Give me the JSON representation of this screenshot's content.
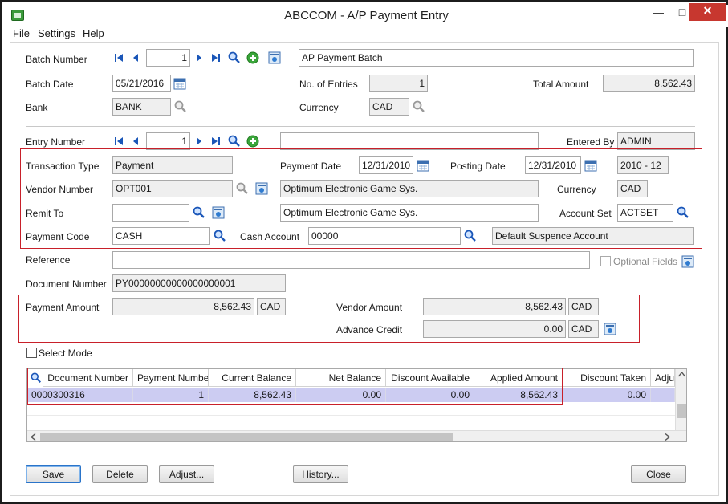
{
  "window": {
    "title": "ABCCOM - A/P Payment Entry",
    "min": "—",
    "max": "□",
    "close": "✕"
  },
  "menu": [
    "File",
    "Settings",
    "Help"
  ],
  "batch": {
    "number_label": "Batch Number",
    "number": "1",
    "description": "AP Payment Batch",
    "date_label": "Batch Date",
    "date": "05/21/2016",
    "entries_label": "No. of Entries",
    "entries": "1",
    "total_label": "Total Amount",
    "total": "8,562.43",
    "bank_label": "Bank",
    "bank": "BANK",
    "currency_label": "Currency",
    "currency": "CAD"
  },
  "entry": {
    "number_label": "Entry Number",
    "number": "1",
    "description": "",
    "entered_by_label": "Entered By",
    "entered_by": "ADMIN",
    "trans_type_label": "Transaction Type",
    "trans_type": "Payment",
    "payment_date_label": "Payment Date",
    "payment_date": "12/31/2010",
    "posting_date_label": "Posting Date",
    "posting_date": "12/31/2010",
    "period": "2010 - 12",
    "vendor_label": "Vendor Number",
    "vendor": "OPT001",
    "vendor_name": "Optimum Electronic Game Sys.",
    "vendor_currency_label": "Currency",
    "vendor_currency": "CAD",
    "remit_label": "Remit To",
    "remit": "",
    "remit_name": "Optimum Electronic Game Sys.",
    "account_set_label": "Account Set",
    "account_set": "ACTSET",
    "payment_code_label": "Payment Code",
    "payment_code": "CASH",
    "cash_account_label": "Cash Account",
    "cash_account": "00000",
    "cash_account_desc": "Default Suspence Account",
    "reference_label": "Reference",
    "reference": "",
    "optional_fields_label": "Optional Fields",
    "document_label": "Document Number",
    "document": "PY00000000000000000001",
    "payment_amount_label": "Payment Amount",
    "payment_amount": "8,562.43",
    "payment_currency": "CAD",
    "vendor_amount_label": "Vendor Amount",
    "vendor_amount": "8,562.43",
    "vendor_amount_currency": "CAD",
    "advance_credit_label": "Advance Credit",
    "advance_credit": "0.00",
    "advance_currency": "CAD",
    "select_mode_label": "Select Mode"
  },
  "grid": {
    "columns": [
      "Document Number",
      "Payment Number",
      "Current Balance",
      "Net Balance",
      "Discount Available",
      "Applied Amount",
      "Discount Taken",
      "Adju"
    ],
    "rows": [
      [
        "0000300316",
        "1",
        "8,562.43",
        "0.00",
        "0.00",
        "8,562.43",
        "0.00",
        ""
      ]
    ]
  },
  "buttons": {
    "save": "Save",
    "delete": "Delete",
    "adjust": "Adjust...",
    "history": "History...",
    "close": "Close"
  },
  "colors": {
    "highlight_box": "#c8202a",
    "selected_row": "#ccccf2",
    "close_button": "#c7372f"
  }
}
